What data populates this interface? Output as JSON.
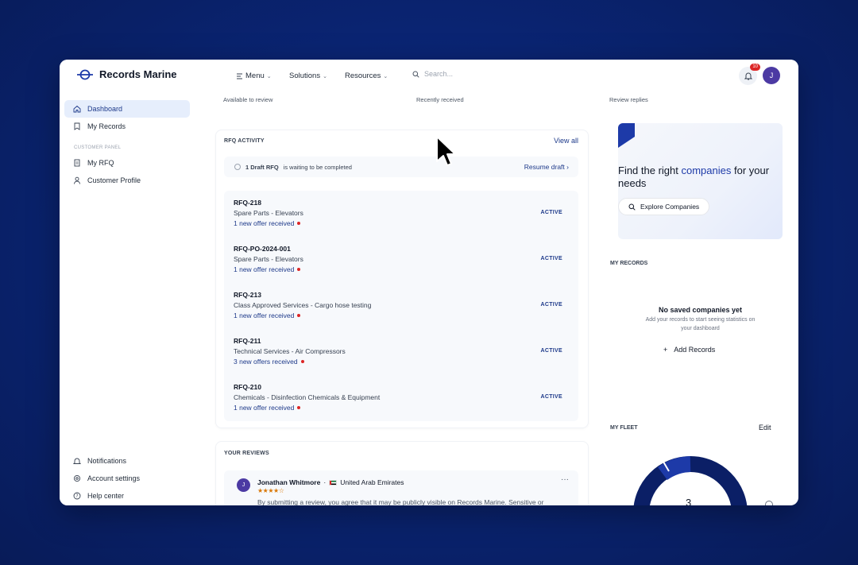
{
  "app": {
    "name": "Records Marine"
  },
  "header": {
    "nav": [
      {
        "label": "Menu",
        "icon": "menu-icon"
      },
      {
        "label": "Solutions"
      },
      {
        "label": "Resources"
      }
    ],
    "search_placeholder": "Search...",
    "notification_count": "10",
    "user_initial": "J"
  },
  "sidebar": {
    "items": [
      {
        "label": "Dashboard",
        "icon": "home-icon",
        "active": true
      },
      {
        "label": "My Records",
        "icon": "bookmark-icon"
      }
    ],
    "section_label": "CUSTOMER PANEL",
    "customer_items": [
      {
        "label": "My RFQ",
        "icon": "document-icon"
      },
      {
        "label": "Customer Profile",
        "icon": "user-icon"
      }
    ],
    "bottom_items": [
      {
        "label": "Notifications",
        "icon": "bell-icon"
      },
      {
        "label": "Account settings",
        "icon": "gear-icon"
      },
      {
        "label": "Help center",
        "icon": "help-icon"
      }
    ]
  },
  "stats": {
    "card1": "Available to review",
    "card2": "Recently received",
    "card3": "Review replies"
  },
  "rfq_activity": {
    "title": "RFQ ACTIVITY",
    "view_all": "View all",
    "draft_bold": "1 Draft RFQ",
    "draft_rest": "is waiting to be completed",
    "resume": "Resume draft",
    "items": [
      {
        "id": "RFQ-218",
        "desc": "Spare Parts - Elevators",
        "offer": "1 new offer received",
        "status": "ACTIVE"
      },
      {
        "id": "RFQ-PO-2024-001",
        "desc": "Spare Parts - Elevators",
        "offer": "1 new offer received",
        "status": "ACTIVE"
      },
      {
        "id": "RFQ-213",
        "desc": "Class Approved Services - Cargo hose testing",
        "offer": "1 new offer received",
        "status": "ACTIVE"
      },
      {
        "id": "RFQ-211",
        "desc": "Technical Services - Air Compressors",
        "offer": "3 new offers received",
        "status": "ACTIVE"
      },
      {
        "id": "RFQ-210",
        "desc": "Chemicals - Disinfection Chemicals & Equipment",
        "offer": "1 new offer received",
        "status": "ACTIVE"
      }
    ]
  },
  "reviews": {
    "title": "YOUR REVIEWS",
    "item": {
      "initial": "J",
      "name": "Jonathan Whitmore",
      "separator": "·",
      "country": "United Arab Emirates",
      "rating": 4,
      "stars": "★★★★☆",
      "text": "By submitting a review, you agree that it may be publicly visible on Records Marine. Sensitive or"
    }
  },
  "promo": {
    "title_pre": "Find the right ",
    "title_highlight": "companies",
    "title_post": " for your needs",
    "button": "Explore Companies"
  },
  "my_records": {
    "title": "MY RECORDS",
    "empty_title": "No saved companies yet",
    "empty_sub": "Add your records to start seeing statistics on your dashboard",
    "add": "Add Records"
  },
  "fleet": {
    "title": "MY FLEET",
    "edit": "Edit",
    "count": "3"
  },
  "colors": {
    "brand": "#1d3aa8",
    "accent_dark": "#1e3a8a",
    "alert": "#dc2626",
    "star": "#d97706"
  }
}
